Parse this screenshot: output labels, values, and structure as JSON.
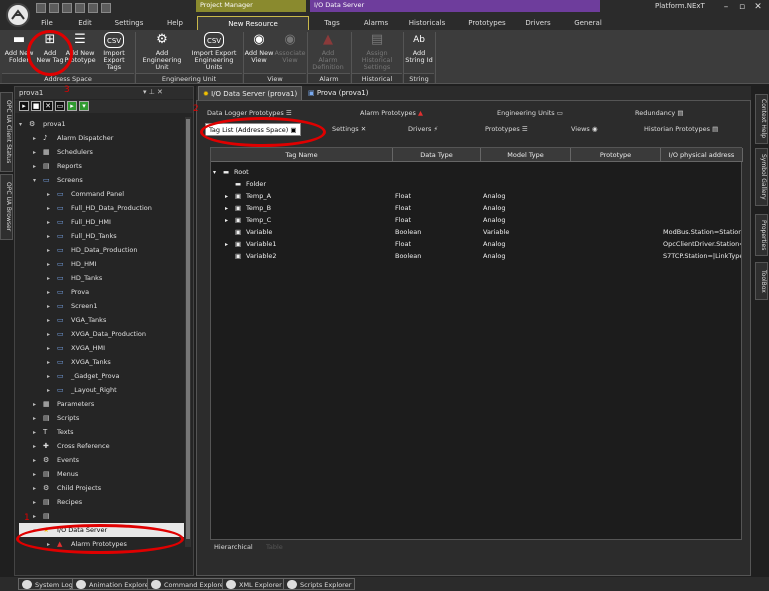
{
  "window": {
    "platform": "Platform.NExT",
    "context_tabs": [
      "Project Manager",
      "I/O Data Server"
    ]
  },
  "ribbon_tabs": [
    "File",
    "Edit",
    "Settings",
    "Help",
    "New Resource",
    "Tags",
    "Alarms",
    "Historicals",
    "Prototypes",
    "Drivers",
    "General"
  ],
  "ribbon": {
    "buttons": [
      {
        "label": "Add New\nFolder",
        "icon": "folder-icon",
        "enabled": true
      },
      {
        "label": "Add\nNew Tag",
        "icon": "add-tag-icon",
        "enabled": true
      },
      {
        "label": "Add New\nPrototype",
        "icon": "add-prototype-icon",
        "enabled": true
      },
      {
        "label": "Import\nExport Tags",
        "icon": "csv-icon",
        "enabled": true
      },
      {
        "label": "Add\nEngineering Unit",
        "icon": "gear-add-icon",
        "enabled": true
      },
      {
        "label": "Import Export\nEngineering Units",
        "icon": "csv-icon",
        "enabled": true
      },
      {
        "label": "Add New\nView",
        "icon": "eye-icon",
        "enabled": true
      },
      {
        "label": "Associate\nView",
        "icon": "eye-icon",
        "enabled": false
      },
      {
        "label": "Add\nAlarm Definition",
        "icon": "alarm-icon",
        "enabled": false
      },
      {
        "label": "Assign Historical\nSettings",
        "icon": "database-icon",
        "enabled": false
      },
      {
        "label": "Add\nString Id",
        "icon": "string-id-icon",
        "enabled": true
      }
    ],
    "groups": [
      "Address Space",
      "Engineering Unit",
      "View",
      "Alarm",
      "Historical",
      "String"
    ]
  },
  "left_vtabs": [
    "OPC UA Client Status",
    "OPC UA Browser"
  ],
  "tree": {
    "title": "prova1",
    "items": [
      {
        "label": "prova1",
        "level": 0,
        "arrow": "▾",
        "icon": "gear"
      },
      {
        "label": "Alarm Dispatcher",
        "level": 1,
        "arrow": "▸",
        "icon": "bell"
      },
      {
        "label": "Schedulers",
        "level": 1,
        "arrow": "▸",
        "icon": "grid"
      },
      {
        "label": "Reports",
        "level": 1,
        "arrow": "▸",
        "icon": "doc"
      },
      {
        "label": "Screens",
        "level": 1,
        "arrow": "▾",
        "icon": "screen"
      },
      {
        "label": "Command Panel",
        "level": 2,
        "arrow": "▸",
        "icon": "screen"
      },
      {
        "label": "Full_HD_Data_Production",
        "level": 2,
        "arrow": "▸",
        "icon": "screen"
      },
      {
        "label": "Full_HD_HMI",
        "level": 2,
        "arrow": "▸",
        "icon": "screen"
      },
      {
        "label": "Full_HD_Tanks",
        "level": 2,
        "arrow": "▸",
        "icon": "screen"
      },
      {
        "label": "HD_Data_Production",
        "level": 2,
        "arrow": "▸",
        "icon": "screen"
      },
      {
        "label": "HD_HMI",
        "level": 2,
        "arrow": "▸",
        "icon": "screen"
      },
      {
        "label": "HD_Tanks",
        "level": 2,
        "arrow": "▸",
        "icon": "screen"
      },
      {
        "label": "Prova",
        "level": 2,
        "arrow": "▸",
        "icon": "screen"
      },
      {
        "label": "Screen1",
        "level": 2,
        "arrow": "▸",
        "icon": "screen"
      },
      {
        "label": "VGA_Tanks",
        "level": 2,
        "arrow": "▸",
        "icon": "screen"
      },
      {
        "label": "XVGA_Data_Production",
        "level": 2,
        "arrow": "▸",
        "icon": "screen"
      },
      {
        "label": "XVGA_HMI",
        "level": 2,
        "arrow": "▸",
        "icon": "screen"
      },
      {
        "label": "XVGA_Tanks",
        "level": 2,
        "arrow": "▸",
        "icon": "screen"
      },
      {
        "label": "_Gadget_Prova",
        "level": 2,
        "arrow": "▸",
        "icon": "screen"
      },
      {
        "label": "_Layout_Right",
        "level": 2,
        "arrow": "▸",
        "icon": "screen"
      },
      {
        "label": "Parameters",
        "level": 1,
        "arrow": "▸",
        "icon": "grid"
      },
      {
        "label": "Scripts",
        "level": 1,
        "arrow": "▸",
        "icon": "doc"
      },
      {
        "label": "Texts",
        "level": 1,
        "arrow": "▸",
        "icon": "text"
      },
      {
        "label": "Cross Reference",
        "level": 1,
        "arrow": "▸",
        "icon": "cross"
      },
      {
        "label": "Events",
        "level": 1,
        "arrow": "▸",
        "icon": "gear"
      },
      {
        "label": "Menus",
        "level": 1,
        "arrow": "▸",
        "icon": "doc"
      },
      {
        "label": "Child Projects",
        "level": 1,
        "arrow": "▸",
        "icon": "gear"
      },
      {
        "label": "Recipes",
        "level": 1,
        "arrow": "▸",
        "icon": "doc"
      },
      {
        "label": "",
        "level": 1,
        "arrow": "▸",
        "icon": "doc"
      },
      {
        "label": "I/O Data Server",
        "level": 1,
        "arrow": "▾",
        "icon": "star",
        "selected": true
      },
      {
        "label": "Alarm Prototypes",
        "level": 2,
        "arrow": "▸",
        "icon": "alarm"
      }
    ]
  },
  "doc_tabs": [
    "I/O Data Server (prova1)",
    "Prova (prova1)"
  ],
  "io": {
    "tabs_row1": [
      "Data Logger Prototypes",
      "Alarm Prototypes",
      "Engineering Units",
      "Redundancy"
    ],
    "tabs_row2": [
      "Tag List (Address Space)",
      "Settings",
      "Drivers",
      "Prototypes",
      "Views",
      "Historian Prototypes"
    ],
    "columns": [
      "Tag Name",
      "Data Type",
      "Model Type",
      "Prototype",
      "I/O physical address"
    ],
    "rows": [
      {
        "name": "Root",
        "level": 0,
        "arrow": "▾",
        "kind": "folder",
        "type": "",
        "model": "",
        "proto": "",
        "addr": ""
      },
      {
        "name": "Folder",
        "level": 1,
        "arrow": "",
        "kind": "folder",
        "type": "",
        "model": "",
        "proto": "",
        "addr": ""
      },
      {
        "name": "Temp_A",
        "level": 1,
        "arrow": "▸",
        "kind": "tag",
        "type": "Float",
        "model": "Analog",
        "proto": "",
        "addr": ""
      },
      {
        "name": "Temp_B",
        "level": 1,
        "arrow": "▸",
        "kind": "tag",
        "type": "Float",
        "model": "Analog",
        "proto": "",
        "addr": ""
      },
      {
        "name": "Temp_C",
        "level": 1,
        "arrow": "▸",
        "kind": "tag",
        "type": "Float",
        "model": "Analog",
        "proto": "",
        "addr": ""
      },
      {
        "name": "Variable",
        "level": 1,
        "arrow": "",
        "kind": "tag",
        "type": "Boolean",
        "model": "Variable",
        "proto": "",
        "addr": "ModBus.Station=Station0|L"
      },
      {
        "name": "Variable1",
        "level": 1,
        "arrow": "▸",
        "kind": "tag",
        "type": "Float",
        "model": "Analog",
        "proto": "",
        "addr": "OpcClientDriver.Station=St"
      },
      {
        "name": "Variable2",
        "level": 1,
        "arrow": "",
        "kind": "tag",
        "type": "Boolean",
        "model": "Analog",
        "proto": "",
        "addr": "S7TCP.Station=|LinkType="
      }
    ],
    "bottom_tabs": [
      "Hierarchical",
      "Table"
    ]
  },
  "right_vtabs": [
    "Context Help",
    "Symbol Gallery",
    "Properties",
    "ToolBox"
  ],
  "bottom_bar": [
    "System Log",
    "Animation Explorer",
    "Command Explorer",
    "XML Explorer",
    "Scripts Explorer"
  ],
  "annotations": [
    "1",
    "2",
    "3"
  ],
  "colors": {
    "annotation": "#e00000",
    "context_pm": "#8a8a2e",
    "context_io": "#6e3d9c"
  }
}
